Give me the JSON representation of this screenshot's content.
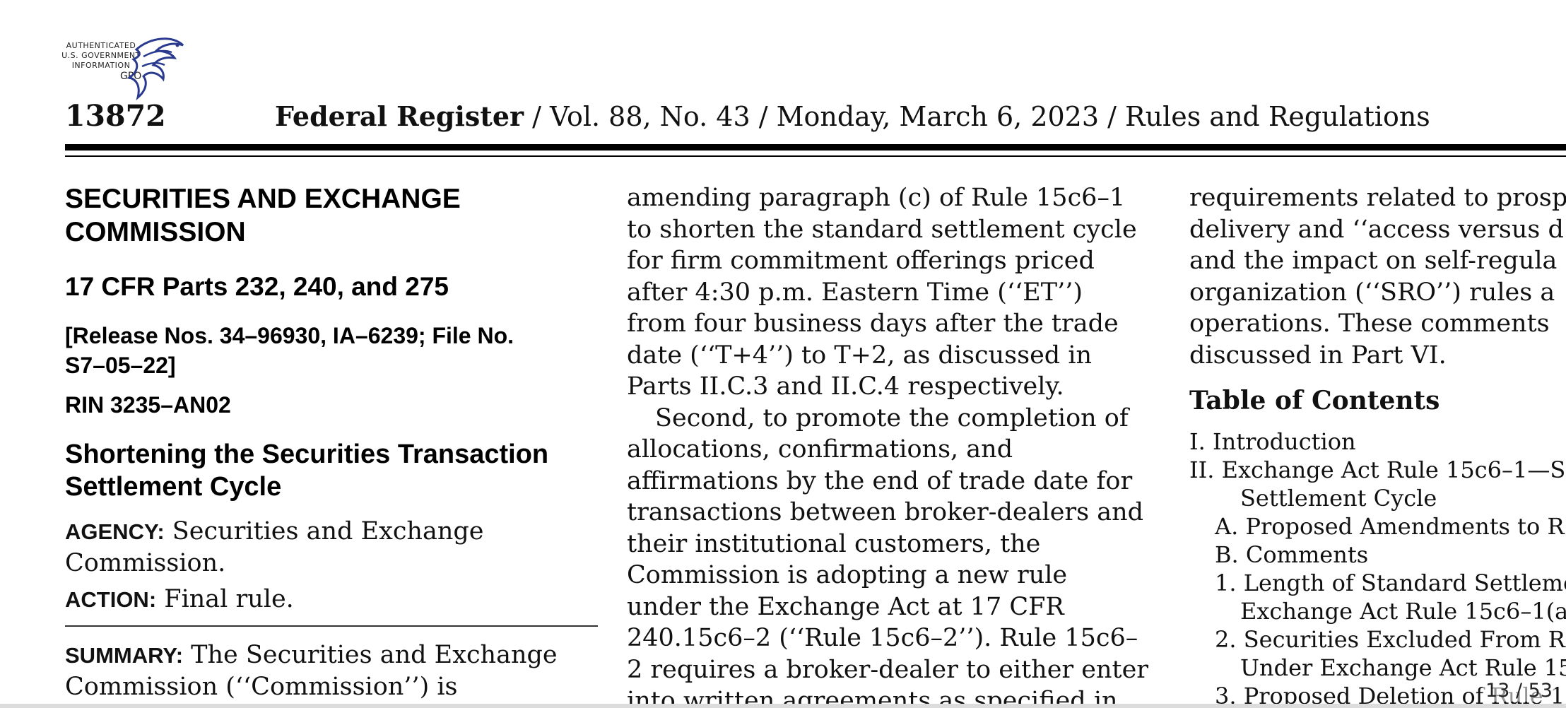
{
  "seal": {
    "line1": "AUTHENTICATED",
    "line2": "U.S. GOVERNMENT",
    "line3": "INFORMATION",
    "line4": "GPO"
  },
  "header": {
    "page_number": "13872",
    "publication": "Federal Register",
    "issue": " / Vol. 88, No. 43 / Monday, March 6, 2023 / Rules and Regulations"
  },
  "column1": {
    "agency_title_1": "SECURITIES AND EXCHANGE",
    "agency_title_2": "COMMISSION",
    "cfr_parts": "17 CFR Parts 232, 240, and 275",
    "release_1": "[Release Nos. 34–96930, IA–6239; File No.",
    "release_2": "S7–05–22]",
    "rin": "RIN 3235–AN02",
    "title_1": "Shortening the Securities Transaction",
    "title_2": "Settlement Cycle",
    "agency_label": "AGENCY:",
    "agency_text_1": " Securities and Exchange",
    "agency_text_2": "Commission.",
    "action_label": "ACTION:",
    "action_text": " Final rule.",
    "summary_label": "SUMMARY:",
    "summary_text_1": " The Securities and Exchange",
    "summary_text_2": "Commission (‘‘Commission’’) is"
  },
  "column2": {
    "lines": [
      "amending paragraph (c) of Rule 15c6–1",
      "to shorten the standard settlement cycle",
      "for firm commitment offerings priced",
      "after 4:30 p.m. Eastern Time (‘‘ET’’)",
      "from four business days after the trade",
      "date (‘‘T+4’’) to T+2, as discussed in",
      "Parts II.C.3 and II.C.4 respectively.",
      "Second, to promote the completion of",
      "allocations, confirmations, and",
      "affirmations by the end of trade date for",
      "transactions between broker-dealers and",
      "their institutional customers, the",
      "Commission is adopting a new rule",
      "under the Exchange Act at 17 CFR",
      "240.15c6–2 (‘‘Rule 15c6–2’’). Rule 15c6–",
      "2 requires a broker-dealer to either enter",
      "into written agreements as specified in"
    ]
  },
  "column3": {
    "lines": [
      "requirements related to prosp",
      "delivery and ‘‘access versus d",
      "and the impact on self-regula",
      "organization (‘‘SRO’’) rules a",
      "operations. These comments",
      "discussed in Part VI."
    ],
    "toc_heading": "Table of Contents",
    "toc": [
      "I. Introduction",
      "II. Exchange Act Rule 15c6–1—S",
      "Settlement Cycle",
      "A. Proposed Amendments to R",
      "B. Comments",
      "1. Length of Standard Settleme",
      "Exchange Act Rule 15c6–1(a",
      "2. Securities Excluded From R",
      "Under Exchange Act Rule 15",
      "3. Proposed Deletion of Rule 1"
    ]
  },
  "viewer": {
    "page_indicator": "13 / 53"
  }
}
